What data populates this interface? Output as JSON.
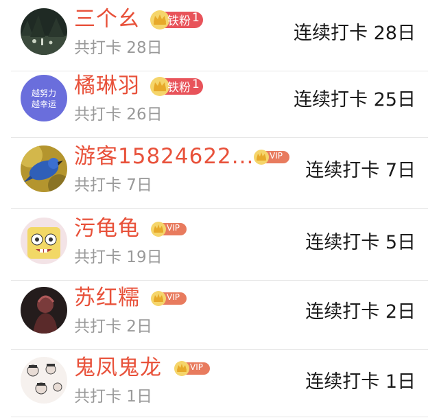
{
  "list": {
    "rows": [
      {
        "name": "三个幺",
        "badge_type": "fan",
        "badge_label": "铁粉",
        "badge_level": "1",
        "total": "共打卡 28日",
        "streak": "连续打卡 28日",
        "avatar": "night-forest-avatar"
      },
      {
        "name": "橘琳羽",
        "badge_type": "fan",
        "badge_label": "铁粉",
        "badge_level": "1",
        "total": "共打卡 26日",
        "streak": "连续打卡 25日",
        "avatar": "text-logo-avatar",
        "avatar_text_1": "越努力",
        "avatar_text_2": "越幸运"
      },
      {
        "name": "游客15824622...",
        "badge_type": "vip",
        "badge_label": "VIP",
        "total": "共打卡 7日",
        "streak": "连续打卡 7日",
        "avatar": "blue-bird-avatar"
      },
      {
        "name": "污龟龟",
        "badge_type": "vip",
        "badge_label": "VIP",
        "total": "共打卡 19日",
        "streak": "连续打卡 5日",
        "avatar": "cartoon-sponge-avatar"
      },
      {
        "name": "苏红糯",
        "badge_type": "vip",
        "badge_label": "VIP",
        "total": "共打卡 2日",
        "streak": "连续打卡 2日",
        "avatar": "dark-figure-avatar"
      },
      {
        "name": "鬼凤鬼龙",
        "badge_type": "vip",
        "badge_label": "VIP",
        "total": "共打卡 1日",
        "streak": "连续打卡 1日",
        "avatar": "sketch-faces-avatar"
      }
    ]
  },
  "colors": {
    "name": "#e8513a",
    "secondary_text": "#999999",
    "primary_text": "#1a1a1a",
    "badge_fan": "#e8535a",
    "badge_vip": "#e87b5e",
    "crown": "#f3c44a"
  }
}
